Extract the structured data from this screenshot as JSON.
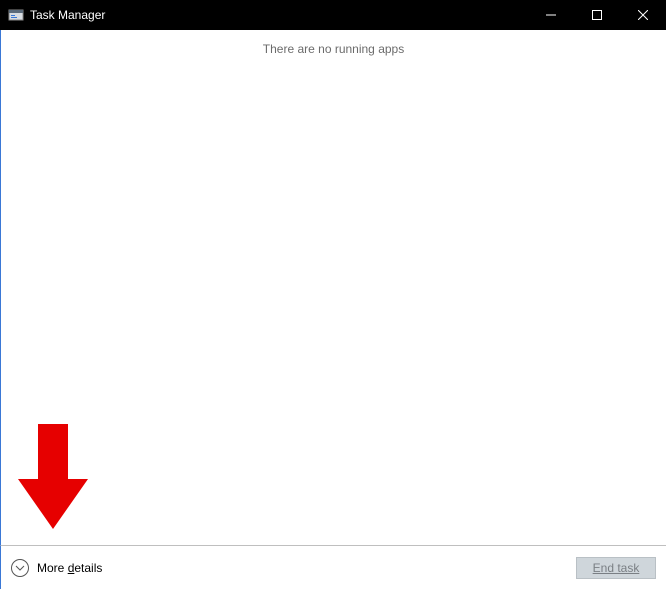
{
  "window": {
    "title": "Task Manager"
  },
  "content": {
    "empty_message": "There are no running apps"
  },
  "footer": {
    "more_details_label": "More details",
    "end_task_label": "End task"
  },
  "annotation": {
    "arrow_color": "#e60000"
  }
}
